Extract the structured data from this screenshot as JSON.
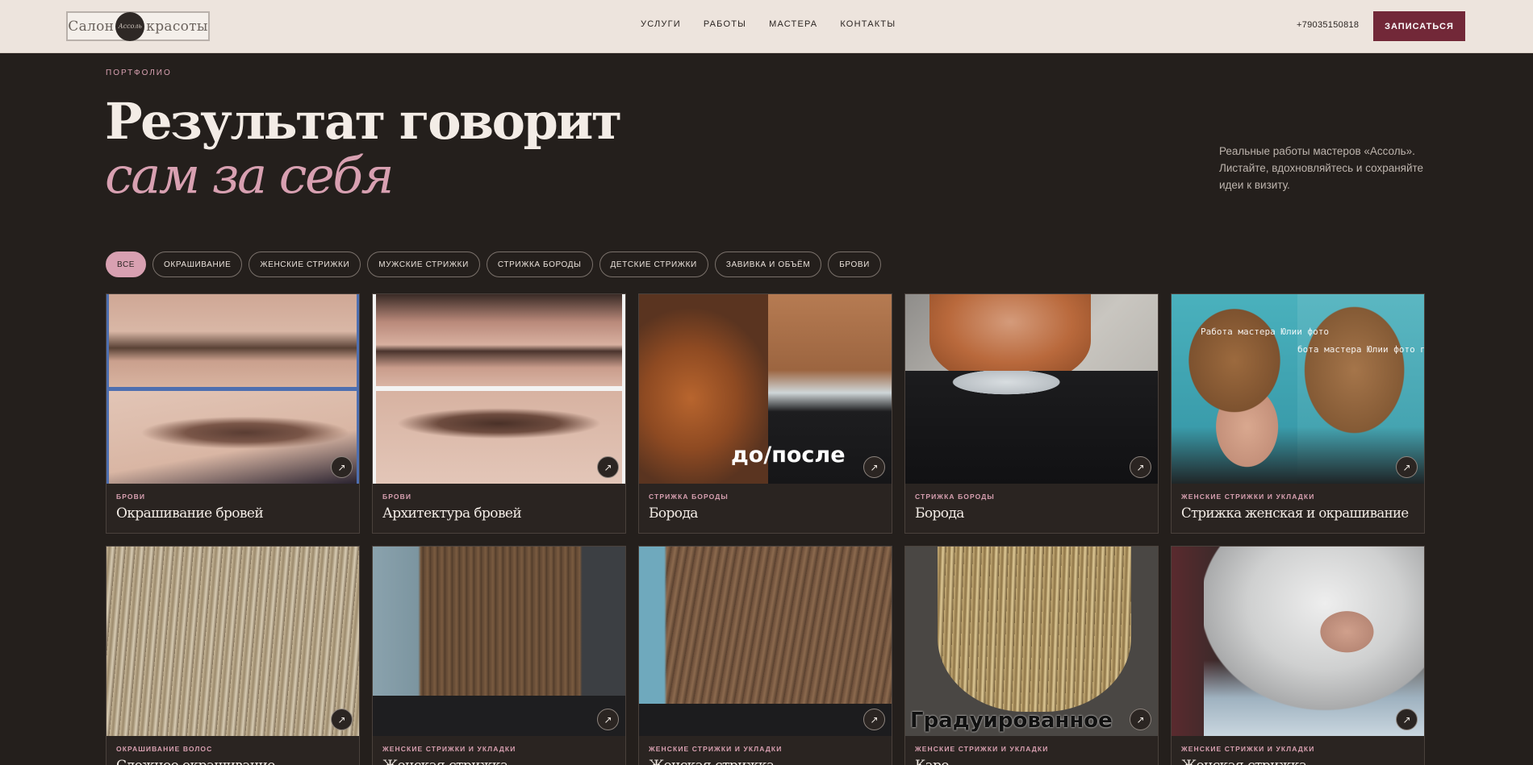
{
  "header": {
    "logo": {
      "left": "Салон",
      "badge": "Ассоль",
      "right": "красоты"
    },
    "nav": [
      "УСЛУГИ",
      "РАБОТЫ",
      "МАСТЕРА",
      "КОНТАКТЫ"
    ],
    "phone": "+79035150818",
    "cta": "ЗАПИСАТЬСЯ"
  },
  "hero": {
    "eyebrow": "ПОРТФОЛИО",
    "title_line1": "Результат говорит",
    "title_line2": "сам за себя",
    "intro": "Реальные работы мастеров «Ассоль». Листайте, вдохновляйтесь и сохраняйте идеи к визиту."
  },
  "filters": [
    "ВСЕ",
    "ОКРАШИВАНИЕ",
    "ЖЕНСКИЕ СТРИЖКИ",
    "МУЖСКИЕ СТРИЖКИ",
    "СТРИЖКА БОРОДЫ",
    "ДЕТСКИЕ СТРИЖКИ",
    "ЗАВИВКА И ОБЪЁМ",
    "БРОВИ"
  ],
  "active_filter": "ВСЕ",
  "cards": [
    {
      "category": "БРОВИ",
      "title": "Окрашивание бровей"
    },
    {
      "category": "БРОВИ",
      "title": "Архитектура бровей"
    },
    {
      "category": "СТРИЖКА БОРОДЫ",
      "title": "Борода",
      "overlay": "до/после"
    },
    {
      "category": "СТРИЖКА БОРОДЫ",
      "title": "Борода"
    },
    {
      "category": "ЖЕНСКИЕ СТРИЖКИ И УКЛАДКИ",
      "title": "Стрижка женская и окрашивание",
      "watermark_left": "Работа мастера Юлии фото",
      "watermark_right": "бота мастера Юлии фото пос"
    },
    {
      "category": "ОКРАШИВАНИЕ ВОЛОС",
      "title": "Сложное окрашивание"
    },
    {
      "category": "ЖЕНСКИЕ СТРИЖКИ И УКЛАДКИ",
      "title": "Женская стрижка"
    },
    {
      "category": "ЖЕНСКИЕ СТРИЖКИ И УКЛАДКИ",
      "title": "Женская стрижка"
    },
    {
      "category": "ЖЕНСКИЕ СТРИЖКИ И УКЛАДКИ",
      "title": "Каре",
      "overlay": "Градуированное"
    },
    {
      "category": "ЖЕНСКИЕ СТРИЖКИ И УКЛАДКИ",
      "title": "Женская стрижка"
    }
  ],
  "arrow_icon": "↗",
  "colors": {
    "header_bg": "#ede4dd",
    "page_bg": "#241f1c",
    "accent_pink": "#d8a0b1",
    "cta_bg": "#722838"
  }
}
